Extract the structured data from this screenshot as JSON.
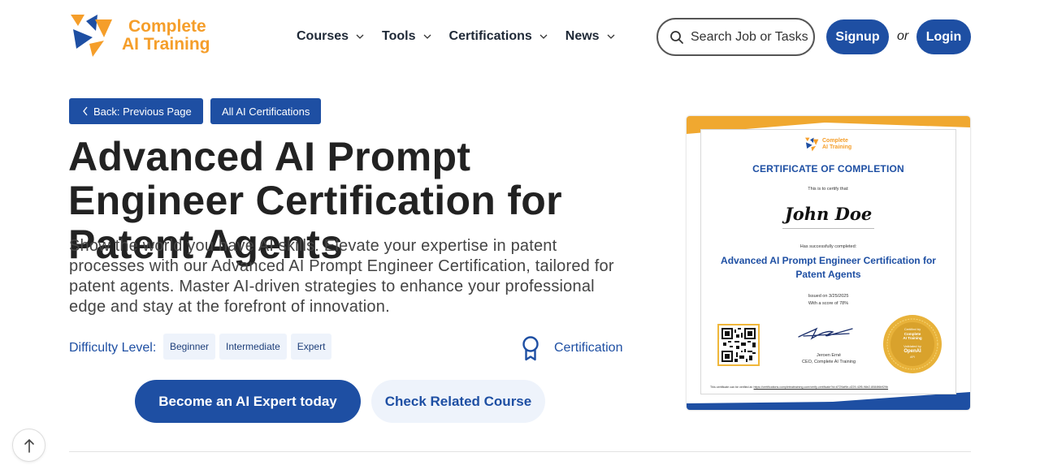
{
  "header": {
    "logo": {
      "line1": "Complete",
      "line2": "AI Training"
    },
    "nav": [
      {
        "label": "Courses"
      },
      {
        "label": "Tools"
      },
      {
        "label": "Certifications"
      },
      {
        "label": "News"
      }
    ],
    "search": {
      "placeholder": "Search Job or Tasks"
    },
    "signup_label": "Signup",
    "or_text": "or",
    "login_label": "Login"
  },
  "breadcrumbs": {
    "back_label": "Back: Previous Page",
    "all_certs_label": "All AI Certifications"
  },
  "main": {
    "title": "Advanced AI Prompt Engineer Certification for Patent Agents",
    "description": "Show the world you have AI skills. Elevate your expertise in patent processes with our Advanced AI Prompt Engineer Certification, tailored for patent agents. Master AI-driven strategies to enhance your professional edge and stay at the forefront of innovation.",
    "difficulty_label": "Difficulty Level:",
    "difficulty_levels": [
      "Beginner",
      "Intermediate",
      "Expert"
    ],
    "type_label": "Certification",
    "cta_primary": "Become an AI Expert today",
    "cta_secondary": "Check Related Course"
  },
  "certificate": {
    "logo_line1": "Complete",
    "logo_line2": "AI Training",
    "heading": "CERTIFICATE OF COMPLETION",
    "certify_text": "This is to certify that:",
    "name": "John Doe",
    "completed_text": "Has successfully completed:",
    "course": "Advanced AI Prompt Engineer Certification for Patent Agents",
    "issued": "Issued on 3/25/2025",
    "score": "With a score of 78%",
    "signer_name": "Jeroen Erné",
    "signer_title": "CEO, Complete AI Training",
    "seal_top": "Certified by",
    "seal_mid1": "Complete",
    "seal_mid2": "AI Training",
    "seal_validated": "Validated by",
    "seal_brand": "OpenAI",
    "seal_api": "API",
    "verify_prefix": "This certificate can be verified at:",
    "verify_url": "https://certifications.completeaitraining.com/verify-certificate?id=6729af9e-d229-42f5-98e2-8084f6b929b"
  },
  "colors": {
    "primary": "#1e4fa3",
    "accent": "#f59e2a",
    "light_blue": "#eef3fb",
    "gold": "#e8b23a"
  },
  "icons": {
    "search": "search-icon",
    "chevron": "chevron-down-icon",
    "back": "chevron-left-icon",
    "award": "award-ribbon-icon",
    "scroll_top": "arrow-up-icon"
  }
}
